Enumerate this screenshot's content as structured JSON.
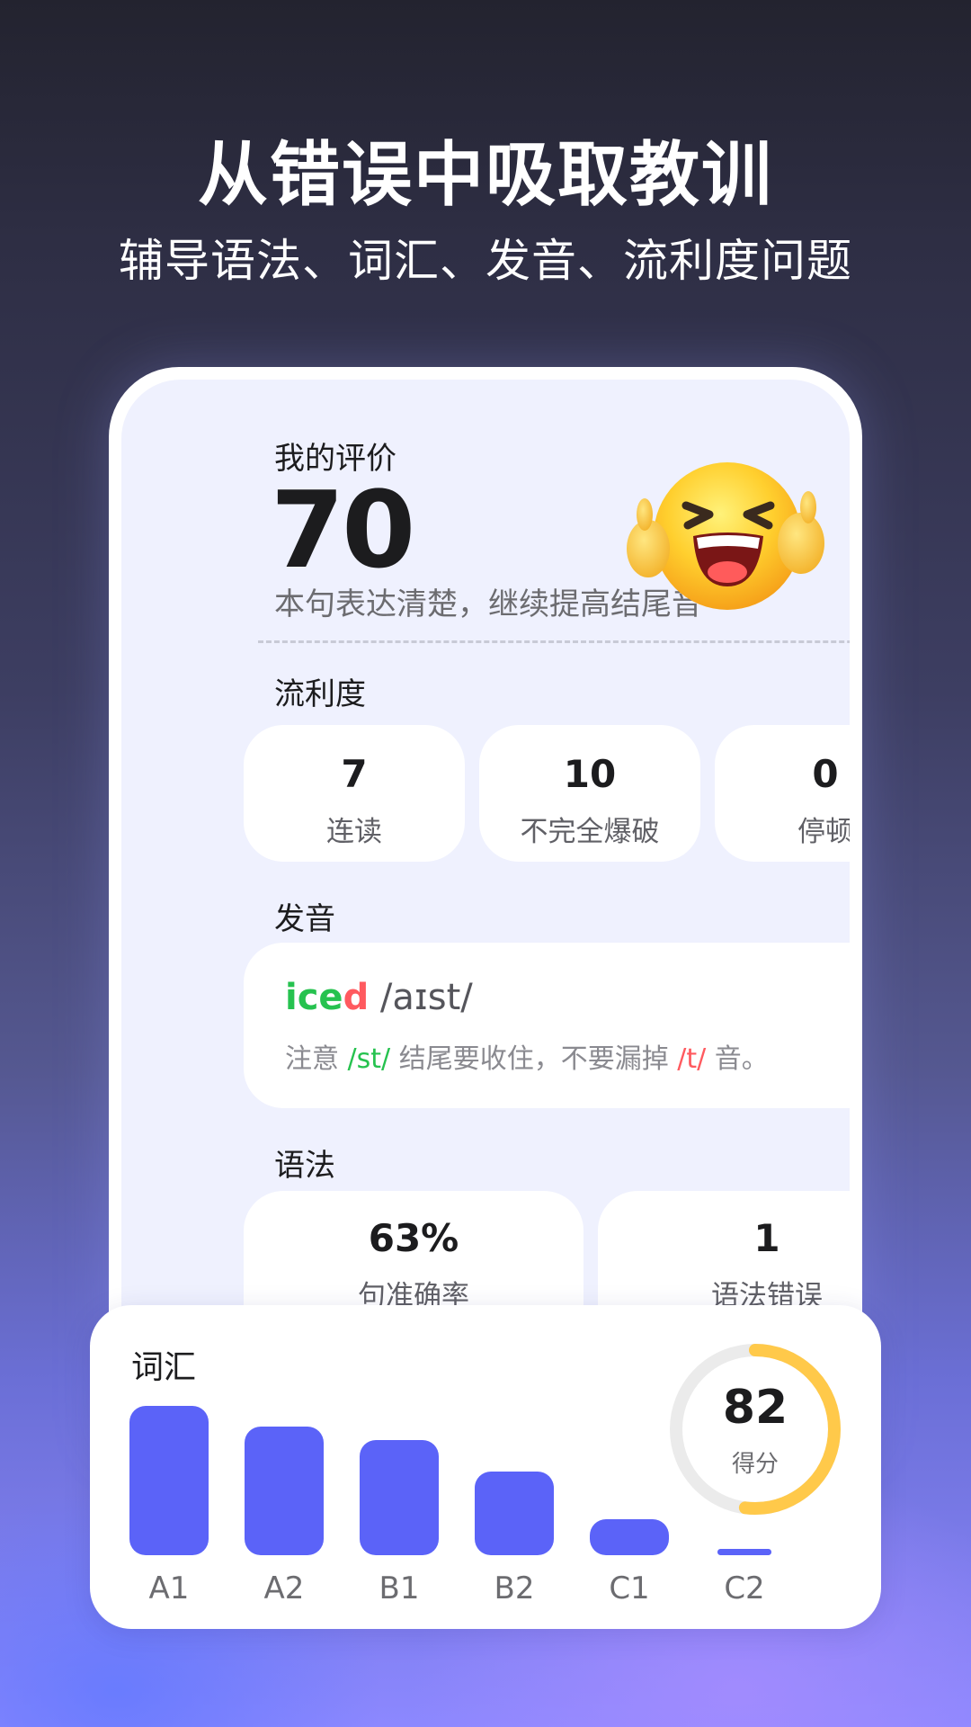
{
  "hero": {
    "title": "从错误中吸取教训",
    "subtitle": "辅导语法、词汇、发音、流利度问题"
  },
  "evaluation": {
    "label": "我的评价",
    "score": "70",
    "comment": "本句表达清楚，继续提高结尾音",
    "emoji_icon": "laughing-thumbs-up-emoji-icon"
  },
  "fluency": {
    "label": "流利度",
    "stats": [
      {
        "value": "7",
        "caption": "连读"
      },
      {
        "value": "10",
        "caption": "不完全爆破"
      },
      {
        "value": "0",
        "caption": "停顿"
      }
    ]
  },
  "pronunciation": {
    "label": "发音",
    "word_correct": "ice",
    "word_error": "d",
    "ipa": " /aɪst/",
    "note_prefix": "注意 ",
    "note_sound_ok": "/st/",
    "note_middle": " 结尾要收住，不要漏掉 ",
    "note_sound_bad": "/t/",
    "note_suffix": " 音。"
  },
  "grammar": {
    "label": "语法",
    "stats": [
      {
        "value": "63%",
        "caption": "句准确率"
      },
      {
        "value": "1",
        "caption": "语法错误"
      }
    ]
  },
  "vocabulary": {
    "label": "词汇",
    "score": "82",
    "score_caption": "得分",
    "score_fraction": 0.52,
    "colors": {
      "bar": "#5b63f8",
      "ring": "#ffc94a",
      "ring_track": "#ebebeb"
    }
  },
  "chart_data": {
    "type": "bar",
    "categories": [
      "A1",
      "A2",
      "B1",
      "B2",
      "C1",
      "C2"
    ],
    "values": [
      100,
      86,
      77,
      56,
      24,
      4
    ],
    "ylim": [
      0,
      100
    ]
  }
}
